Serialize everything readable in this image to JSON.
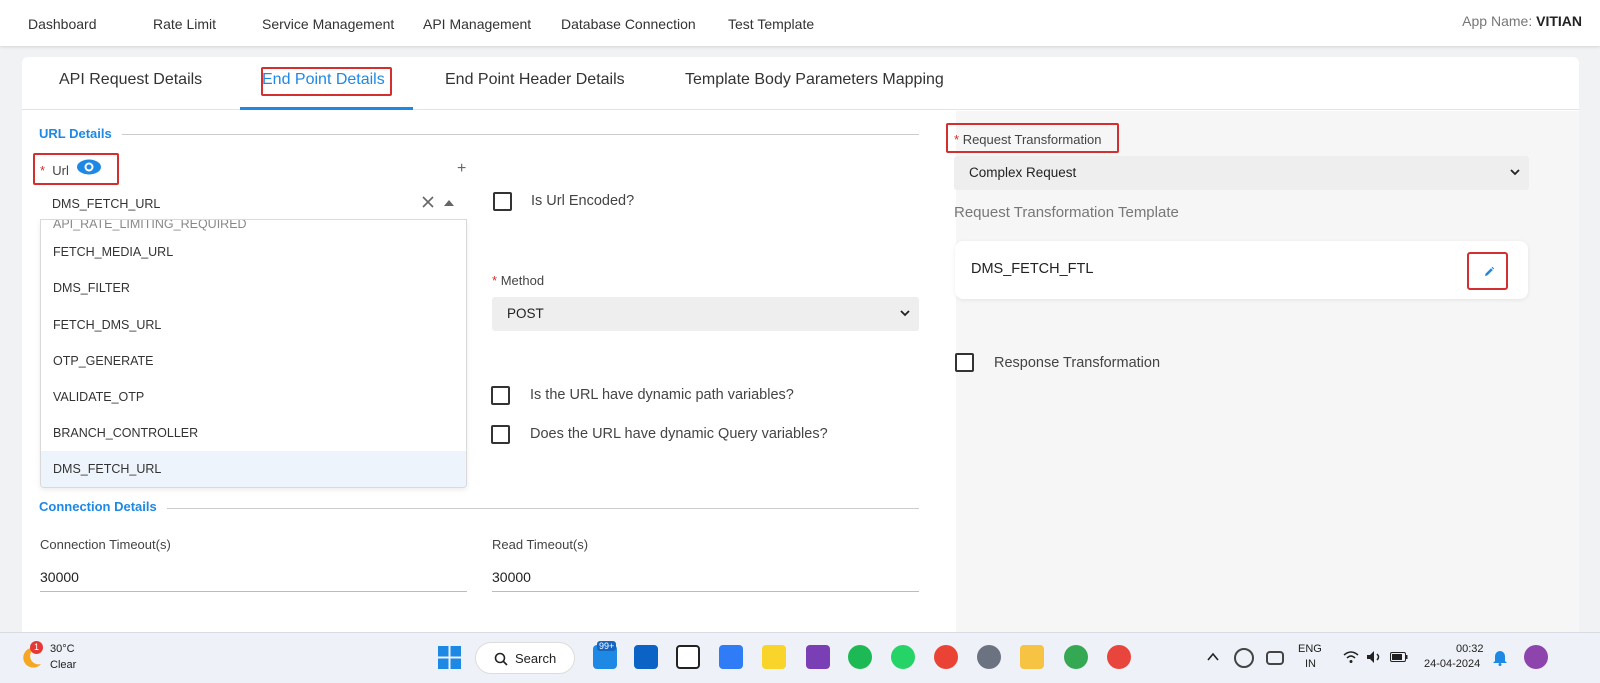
{
  "nav": {
    "items": [
      "Dashboard",
      "Rate Limit",
      "Service Management",
      "API Management",
      "Database Connection",
      "Test Template"
    ],
    "app_name_label": "App Name:",
    "app_name_value": "VITIAN"
  },
  "tabs": [
    "API Request Details",
    "End Point Details",
    "End Point Header Details",
    "Template Body Parameters Mapping"
  ],
  "active_tab": "End Point Details",
  "url_details": {
    "section_title": "URL Details",
    "required_mark": "*",
    "url_label": "Url",
    "url_value": "DMS_FETCH_URL",
    "partial_option": "API_RATE_LIMITING_REQUIRED",
    "options": [
      "FETCH_MEDIA_URL",
      "DMS_FILTER",
      "FETCH_DMS_URL",
      "OTP_GENERATE",
      "VALIDATE_OTP",
      "BRANCH_CONTROLLER",
      "DMS_FETCH_URL"
    ],
    "url_encoded_label": "Is Url Encoded?",
    "method_label": "Method",
    "method_value": "POST",
    "dynamic_path_label": "Is the URL have dynamic path variables?",
    "dynamic_query_label": "Does the URL have dynamic Query variables?"
  },
  "connection_details": {
    "section_title": "Connection Details",
    "connection_timeout_label": "Connection Timeout(s)",
    "connection_timeout_value": "30000",
    "read_timeout_label": "Read Timeout(s)",
    "read_timeout_value": "30000"
  },
  "request_transformation": {
    "label": "Request Transformation",
    "value": "Complex Request",
    "template_title": "Request Transformation Template",
    "template_name": "DMS_FETCH_FTL",
    "response_transformation_label": "Response Transformation"
  },
  "taskbar": {
    "weather_temp": "30°C",
    "weather_condition": "Clear",
    "weather_badge": "1",
    "search_label": "Search",
    "mail_badge": "99+",
    "language": "ENG",
    "region": "IN",
    "time": "00:32",
    "date": "24-04-2024"
  },
  "colors": {
    "accent": "#1e88e5",
    "highlight": "#d32f2f"
  }
}
